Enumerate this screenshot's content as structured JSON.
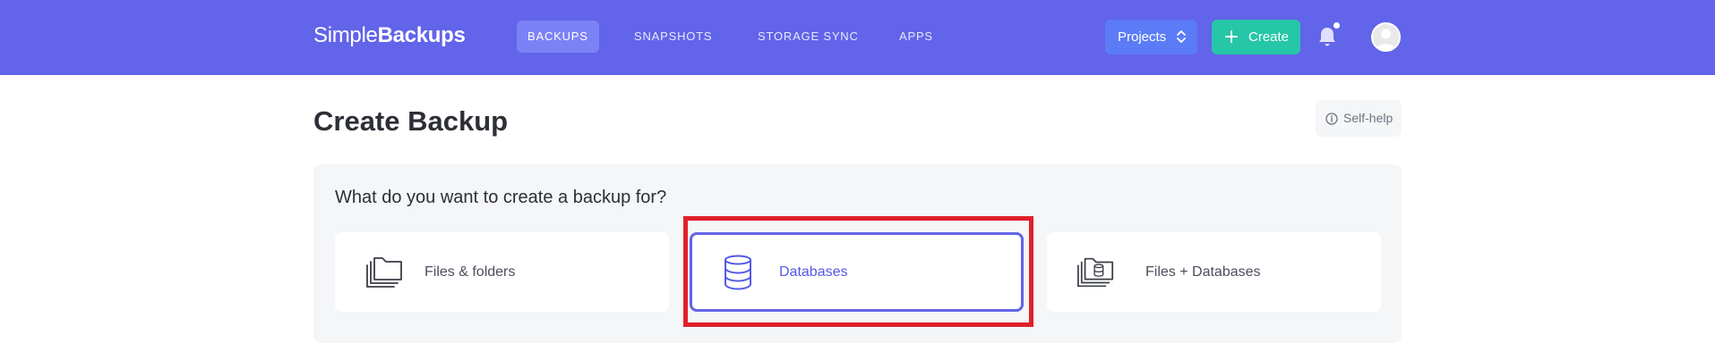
{
  "brand": {
    "name_light": "Simple",
    "name_bold": "Backups"
  },
  "nav": {
    "items": [
      {
        "label": "BACKUPS",
        "active": true
      },
      {
        "label": "SNAPSHOTS",
        "active": false
      },
      {
        "label": "STORAGE SYNC",
        "active": false
      },
      {
        "label": "APPS",
        "active": false
      }
    ],
    "projects_label": "Projects",
    "create_label": "Create",
    "notification_indicator": true
  },
  "page": {
    "title": "Create Backup",
    "self_help_label": "Self-help"
  },
  "backup_type": {
    "question": "What do you want to create a backup for?",
    "options": [
      {
        "label": "Files & folders",
        "icon": "folders-icon",
        "selected": false
      },
      {
        "label": "Databases",
        "icon": "database-icon",
        "selected": true
      },
      {
        "label": "Files + Databases",
        "icon": "folders-database-icon",
        "selected": false
      }
    ]
  },
  "colors": {
    "brand_primary": "#6264e9",
    "create_button": "#26c6a8",
    "projects_button": "#5b7cf6",
    "selected_highlight": "#e0202c"
  }
}
